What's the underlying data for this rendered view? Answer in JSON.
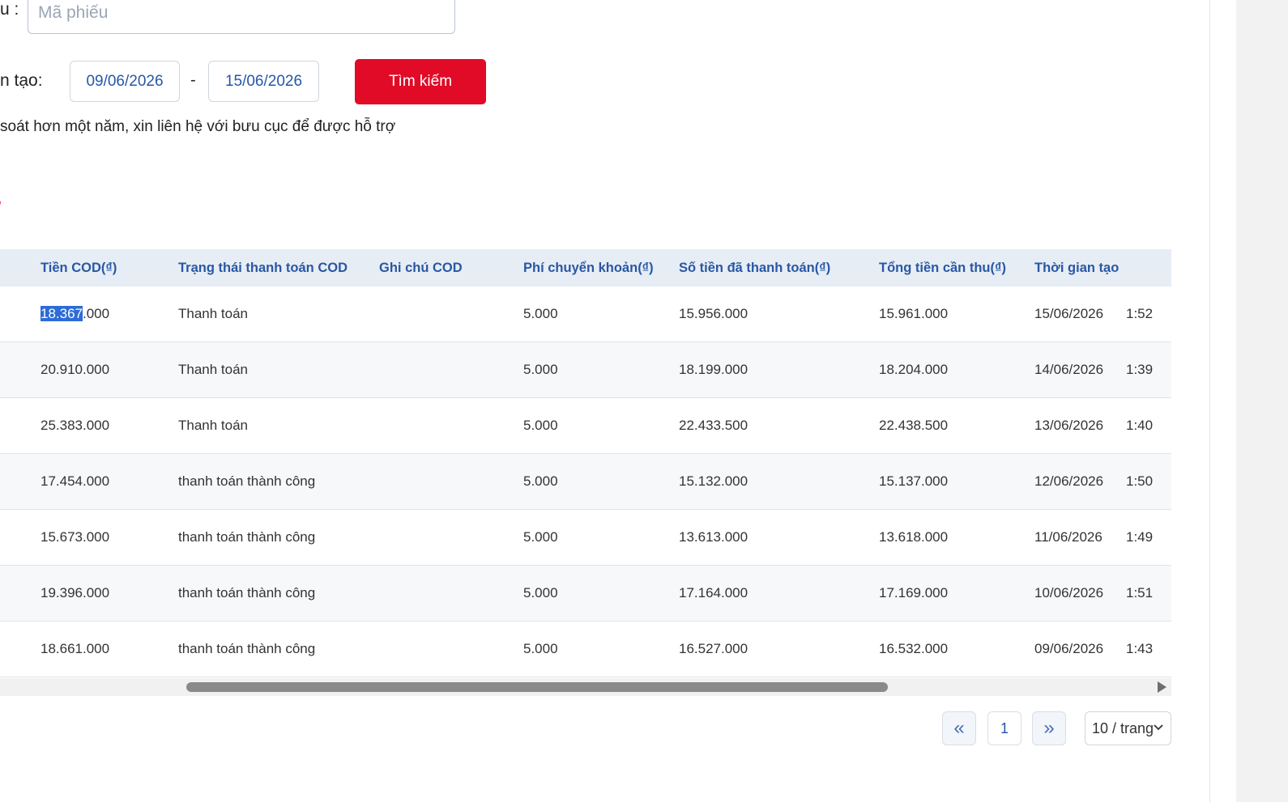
{
  "filters": {
    "code_label": "u :",
    "code_placeholder": "Mã phiếu",
    "date_label": "n tạo:",
    "date_from": "09/06/2026",
    "date_to": "15/06/2026",
    "date_separator": "-",
    "search_button": "Tìm kiếm",
    "note": "soát hơn một năm, xin liên hệ với bưu cục để được hỗ trợ",
    "section_mark": "/"
  },
  "table": {
    "columns": [
      "Tiền COD(₫)",
      "Trạng thái thanh toán COD",
      "Ghi chú COD",
      "Phí chuyển khoản(₫)",
      "Số tiền đã thanh toán(₫)",
      "Tổng tiền cần thu(₫)",
      "Thời gian tạo"
    ],
    "rows": [
      {
        "cod_selected": "18.367",
        "cod_rest": ".000",
        "status": "Thanh toán",
        "note": "",
        "fee": "5.000",
        "paid": "15.956.000",
        "total": "15.961.000",
        "date": "15/06/2026",
        "time": "1:52"
      },
      {
        "cod_selected": "",
        "cod_rest": "20.910.000",
        "status": "Thanh toán",
        "note": "",
        "fee": "5.000",
        "paid": "18.199.000",
        "total": "18.204.000",
        "date": "14/06/2026",
        "time": "1:39"
      },
      {
        "cod_selected": "",
        "cod_rest": "25.383.000",
        "status": "Thanh toán",
        "note": "",
        "fee": "5.000",
        "paid": "22.433.500",
        "total": "22.438.500",
        "date": "13/06/2026",
        "time": "1:40"
      },
      {
        "cod_selected": "",
        "cod_rest": "17.454.000",
        "status": "thanh toán thành công",
        "note": "",
        "fee": "5.000",
        "paid": "15.132.000",
        "total": "15.137.000",
        "date": "12/06/2026",
        "time": "1:50"
      },
      {
        "cod_selected": "",
        "cod_rest": "15.673.000",
        "status": "thanh toán thành công",
        "note": "",
        "fee": "5.000",
        "paid": "13.613.000",
        "total": "13.618.000",
        "date": "11/06/2026",
        "time": "1:49"
      },
      {
        "cod_selected": "",
        "cod_rest": "19.396.000",
        "status": "thanh toán thành công",
        "note": "",
        "fee": "5.000",
        "paid": "17.164.000",
        "total": "17.169.000",
        "date": "10/06/2026",
        "time": "1:51"
      },
      {
        "cod_selected": "",
        "cod_rest": "18.661.000",
        "status": "thanh toán thành công",
        "note": "",
        "fee": "5.000",
        "paid": "16.527.000",
        "total": "16.532.000",
        "date": "09/06/2026",
        "time": "1:43"
      }
    ]
  },
  "pagination": {
    "prev": "«",
    "current": "1",
    "next": "»",
    "page_size": "10 / trang"
  },
  "colors": {
    "accent_red": "#e10a27",
    "header_blue": "#2a57a3",
    "header_bg": "#e6edf5"
  }
}
